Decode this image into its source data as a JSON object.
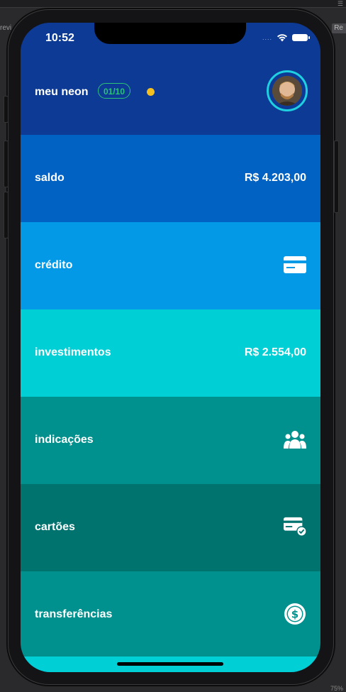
{
  "editor": {
    "left_label": "revi",
    "right_label": "Re",
    "zoom": "75%"
  },
  "status_bar": {
    "time": "10:52",
    "signal": "....",
    "wifi_icon": "wifi-icon",
    "battery_icon": "battery-icon"
  },
  "header": {
    "brand": "meu neon",
    "progress": "01/10",
    "notification_color": "#f4c020",
    "avatar_icon": "avatar"
  },
  "menu": {
    "items": [
      {
        "label": "saldo",
        "value": "R$ 4.203,00",
        "color": "#0262c4"
      },
      {
        "label": "crédito",
        "icon": "credit-card-icon",
        "color": "#0499e6"
      },
      {
        "label": "investimentos",
        "value": "R$ 2.554,00",
        "color": "#00cfd6"
      },
      {
        "label": "indicações",
        "icon": "people-icon",
        "color": "#00918e"
      },
      {
        "label": "cartões",
        "icon": "card-check-icon",
        "color": "#00736f"
      },
      {
        "label": "transferências",
        "icon": "dollar-circle-icon",
        "color": "#00918e"
      }
    ]
  },
  "colors": {
    "header_bg": "#0d3a94",
    "accent_badge": "#2bc27a",
    "avatar_ring": "#1fd0e0",
    "bottom_strip": "#00cfd6"
  }
}
